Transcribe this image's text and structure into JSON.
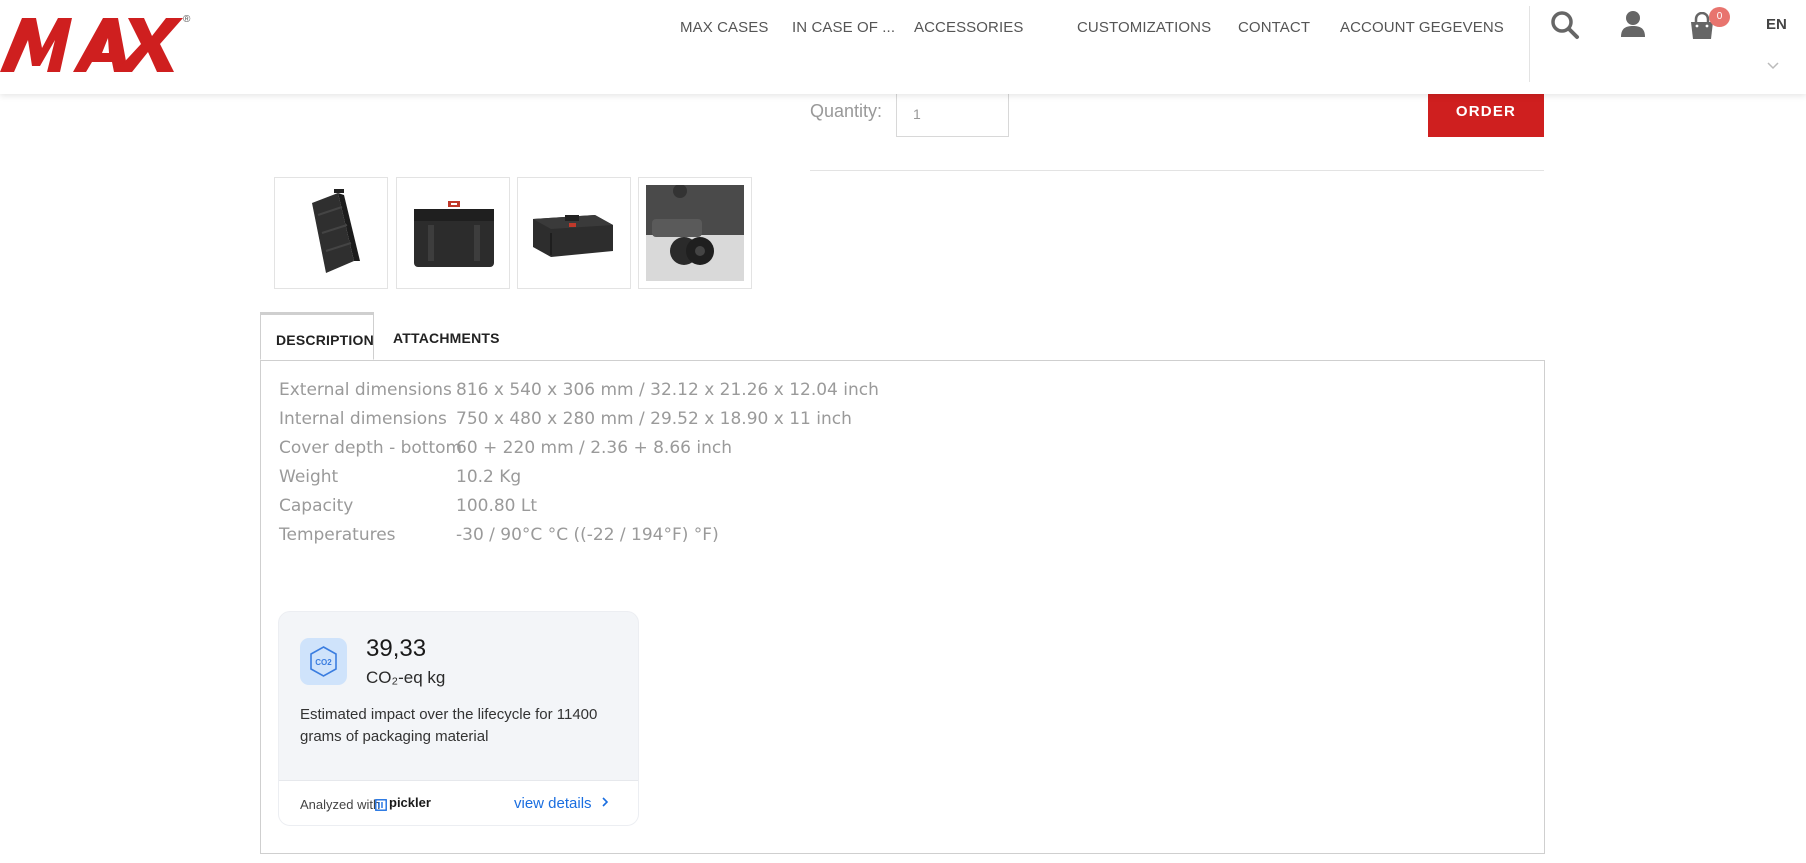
{
  "brand": {
    "logo_text": "MAX",
    "registered_mark": "®",
    "accent": "#cf1f1f"
  },
  "nav": {
    "items": [
      {
        "label": "MAX CASES"
      },
      {
        "label": "IN CASE OF ..."
      },
      {
        "label": "ACCESSORIES"
      },
      {
        "label": "CUSTOMIZATIONS"
      },
      {
        "label": "CONTACT"
      },
      {
        "label": "ACCOUNT GEGEVENS"
      }
    ],
    "cart_count": "0",
    "language": "EN",
    "icons": [
      "search-icon",
      "user-icon",
      "shopping-bag-icon",
      "chevron-down-icon"
    ]
  },
  "order": {
    "quantity_label": "Quantity:",
    "quantity_value": "1",
    "order_label": "ORDER"
  },
  "thumbnails": [
    "case-tilted",
    "case-front",
    "case-open-side",
    "case-wheel-closeup"
  ],
  "tabs": {
    "description": "DESCRIPTION",
    "attachments": "ATTACHMENTS"
  },
  "specs": [
    {
      "label": "External dimensions",
      "value": "816 x 540 x 306 mm / 32.12 x 21.26 x 12.04 inch"
    },
    {
      "label": "Internal dimensions",
      "value": "750 x 480 x 280 mm / 29.52 x 18.90 x 11 inch"
    },
    {
      "label": "Cover depth - bottom",
      "value": "60 + 220 mm / 2.36 + 8.66 inch"
    },
    {
      "label": "Weight",
      "value": "10.2 Kg"
    },
    {
      "label": "Capacity",
      "value": "100.80 Lt"
    },
    {
      "label": "Temperatures",
      "value": "-30 / 90°C °C ((-22 / 194°F) °F)"
    }
  ],
  "co2": {
    "icon_text": "CO2",
    "value": "39,33",
    "unit": "CO₂-eq kg",
    "description": "Estimated impact over the lifecycle for 11400 grams of packaging material",
    "analyzed_with": "Analyzed with",
    "provider": "pickler",
    "view_details": "view details",
    "link_color": "#1a6ee0"
  }
}
